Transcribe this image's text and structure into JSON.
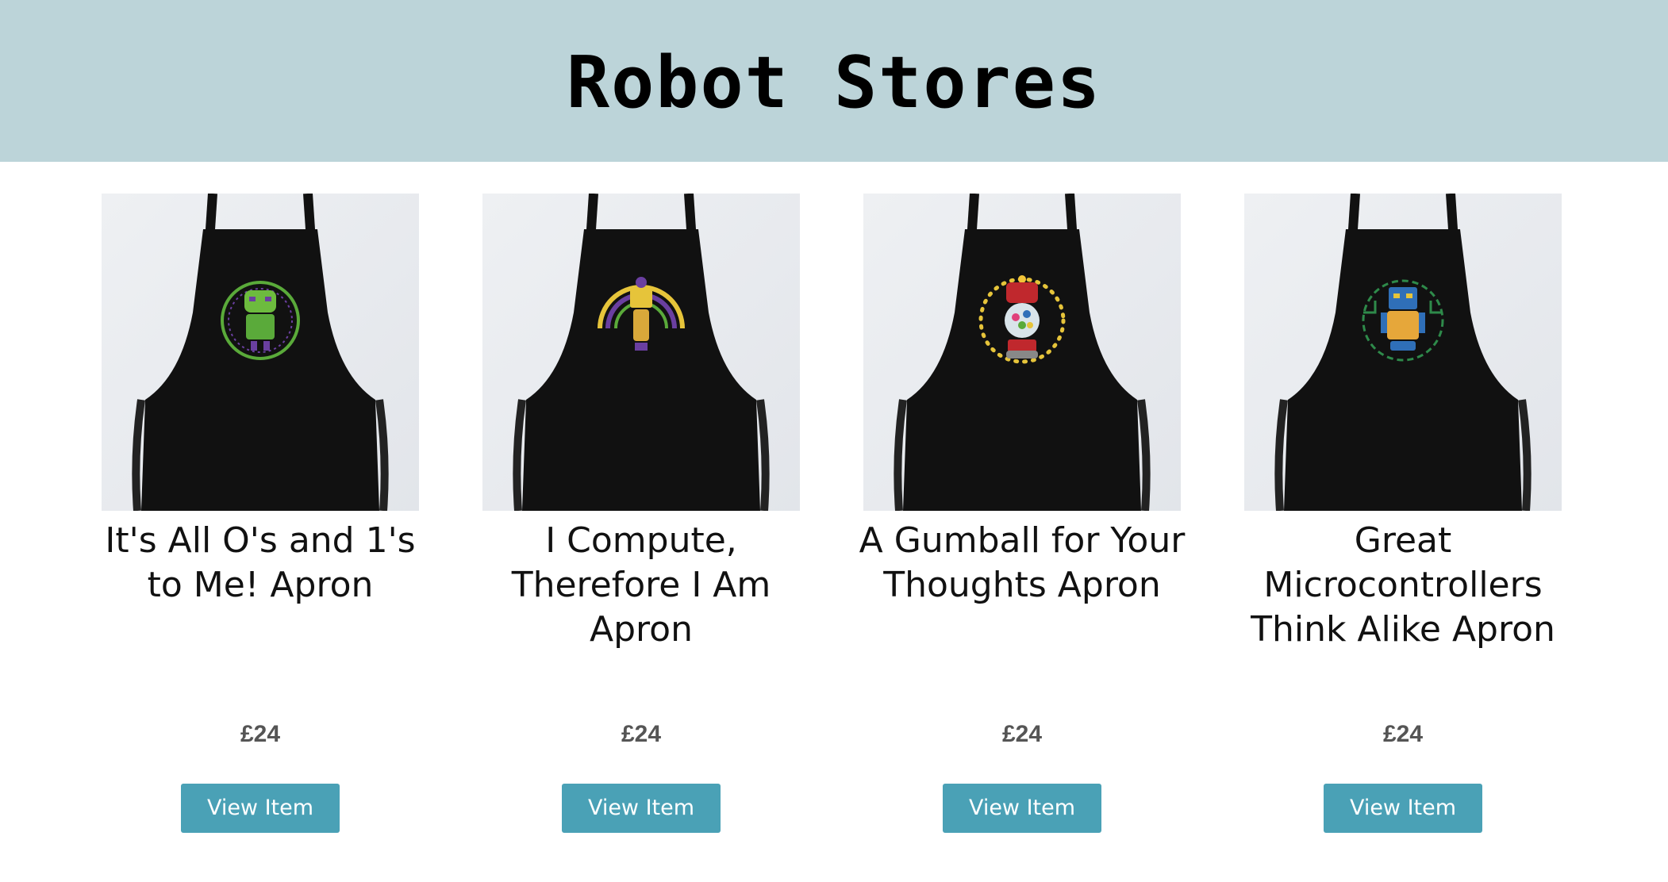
{
  "header": {
    "title": "Robot Stores",
    "background": "#bcd4d9"
  },
  "products": [
    {
      "title": "It's All O's and 1's to Me! Apron",
      "price": "£24",
      "button_label": "View Item",
      "robot_color": "#5aaa3a",
      "badge_text": "IT'S ALL O'S AND 1'S TO ME!"
    },
    {
      "title": "I Compute, Therefore I Am Apron",
      "price": "£24",
      "button_label": "View Item",
      "robot_color": "#e6c43a",
      "badge_text": "I COMPUTE, THEREFORE I AM"
    },
    {
      "title": "A Gumball for Your Thoughts Apron",
      "price": "£24",
      "button_label": "View Item",
      "robot_color": "#c0282d",
      "badge_text": "A GUMBALL FOR YOUR THOUGHTS"
    },
    {
      "title": "Great Microcontrollers Think Alike Apron",
      "price": "£24",
      "button_label": "View Item",
      "robot_color": "#2f6fb8",
      "badge_text": "GREAT MICROCONTROLLERS THINK ALIKE"
    }
  ],
  "colors": {
    "button": "#4aa1b6",
    "price": "#555555",
    "apron": "#111111"
  }
}
